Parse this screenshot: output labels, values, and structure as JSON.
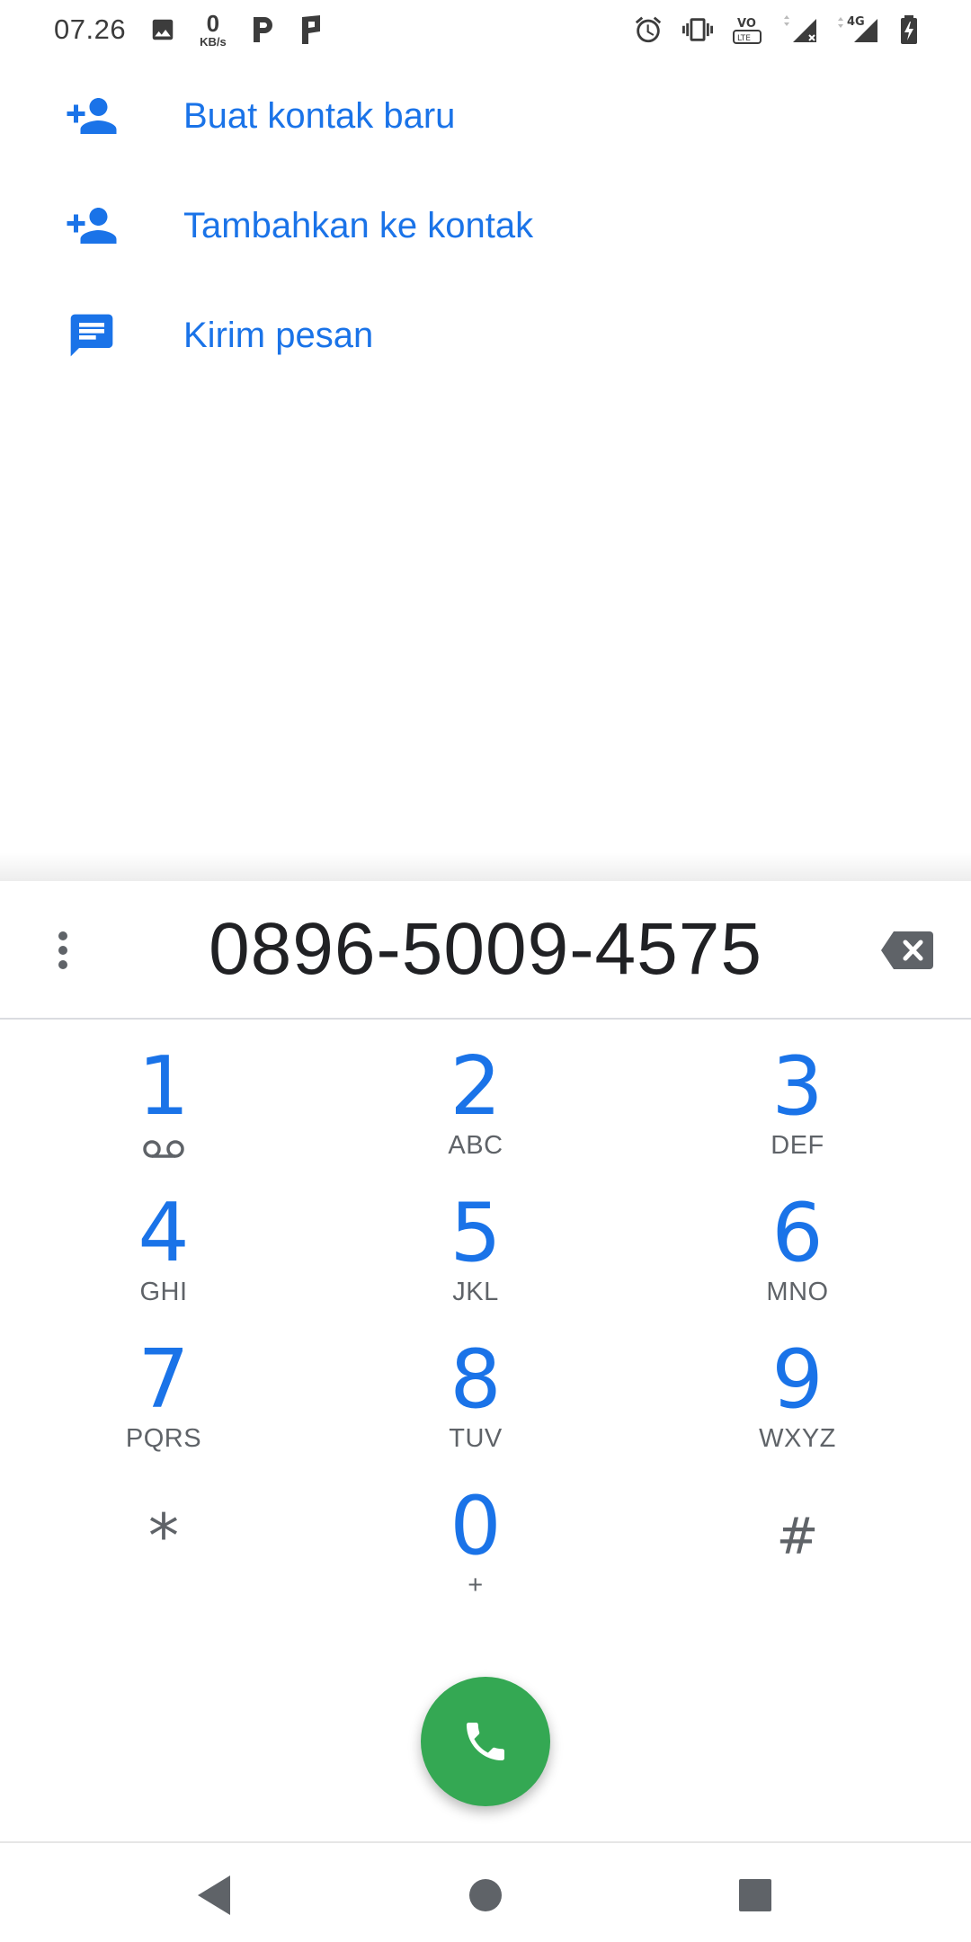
{
  "status_bar": {
    "time": "07.26",
    "net_speed_value": "0",
    "net_speed_unit": "KB/s",
    "network_type": "4G",
    "volte_label": "VO",
    "volte_sub": "LTE",
    "icons": [
      "image-icon",
      "p-app-icon",
      "p-flag-icon",
      "alarm-icon",
      "vibrate-icon",
      "volte-icon",
      "signal-icon",
      "battery-charging-icon"
    ]
  },
  "actions": [
    {
      "label": "Buat kontak baru",
      "icon": "add-person-icon"
    },
    {
      "label": "Tambahkan ke kontak",
      "icon": "add-person-icon"
    },
    {
      "label": "Kirim pesan",
      "icon": "message-icon"
    }
  ],
  "dialer": {
    "digits": "0896-5009-4575",
    "keys": [
      {
        "num": "1",
        "sub": "voicemail"
      },
      {
        "num": "2",
        "sub": "ABC"
      },
      {
        "num": "3",
        "sub": "DEF"
      },
      {
        "num": "4",
        "sub": "GHI"
      },
      {
        "num": "5",
        "sub": "JKL"
      },
      {
        "num": "6",
        "sub": "MNO"
      },
      {
        "num": "7",
        "sub": "PQRS"
      },
      {
        "num": "8",
        "sub": "TUV"
      },
      {
        "num": "9",
        "sub": "WXYZ"
      },
      {
        "sym": "*"
      },
      {
        "num": "0",
        "sub": "+"
      },
      {
        "sym": "#"
      }
    ]
  },
  "colors": {
    "accent": "#1a73e8",
    "call": "#34a853",
    "text": "#202124",
    "secondary": "#5f6368"
  }
}
